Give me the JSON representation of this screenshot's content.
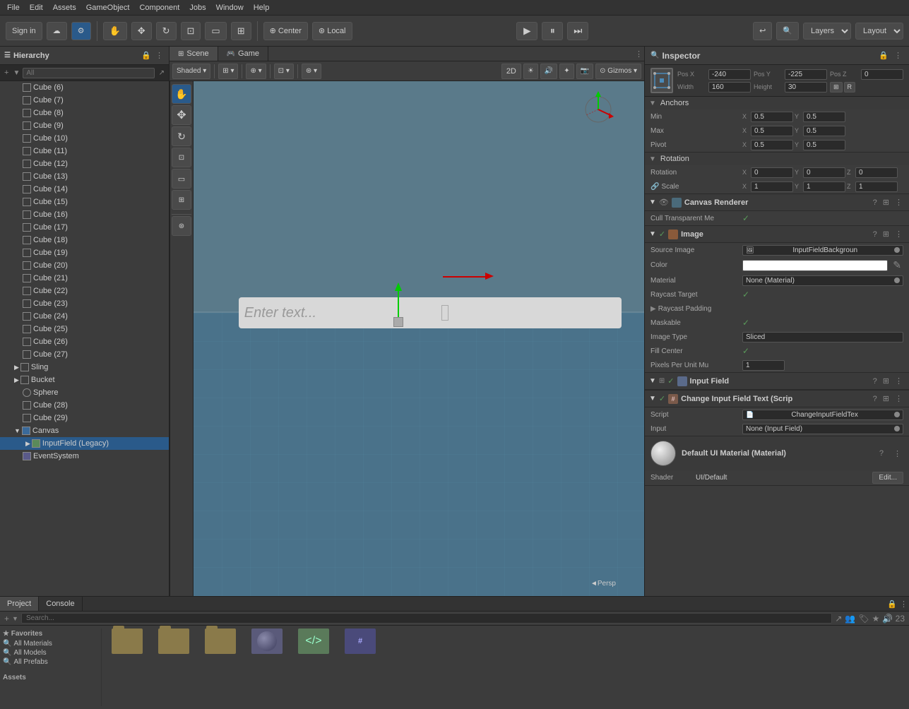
{
  "menubar": {
    "items": [
      "File",
      "Edit",
      "Assets",
      "GameObject",
      "Component",
      "Jobs",
      "Window",
      "Help"
    ]
  },
  "toolbar": {
    "sign_in": "Sign in",
    "layers_label": "Layers",
    "layout_label": "Layout",
    "play_tooltip": "Play",
    "pause_tooltip": "Pause",
    "step_tooltip": "Step"
  },
  "hierarchy": {
    "title": "Hierarchy",
    "search_placeholder": "All",
    "items": [
      {
        "label": "Cube (6)",
        "indent": 0,
        "has_arrow": false
      },
      {
        "label": "Cube (7)",
        "indent": 0,
        "has_arrow": false
      },
      {
        "label": "Cube (8)",
        "indent": 0,
        "has_arrow": false
      },
      {
        "label": "Cube (9)",
        "indent": 0,
        "has_arrow": false
      },
      {
        "label": "Cube (10)",
        "indent": 0,
        "has_arrow": false
      },
      {
        "label": "Cube (11)",
        "indent": 0,
        "has_arrow": false
      },
      {
        "label": "Cube (12)",
        "indent": 0,
        "has_arrow": false
      },
      {
        "label": "Cube (13)",
        "indent": 0,
        "has_arrow": false
      },
      {
        "label": "Cube (14)",
        "indent": 0,
        "has_arrow": false
      },
      {
        "label": "Cube (15)",
        "indent": 0,
        "has_arrow": false
      },
      {
        "label": "Cube (16)",
        "indent": 0,
        "has_arrow": false
      },
      {
        "label": "Cube (17)",
        "indent": 0,
        "has_arrow": false
      },
      {
        "label": "Cube (18)",
        "indent": 0,
        "has_arrow": false
      },
      {
        "label": "Cube (19)",
        "indent": 0,
        "has_arrow": false
      },
      {
        "label": "Cube (20)",
        "indent": 0,
        "has_arrow": false
      },
      {
        "label": "Cube (21)",
        "indent": 0,
        "has_arrow": false
      },
      {
        "label": "Cube (22)",
        "indent": 0,
        "has_arrow": false
      },
      {
        "label": "Cube (23)",
        "indent": 0,
        "has_arrow": false
      },
      {
        "label": "Cube (24)",
        "indent": 0,
        "has_arrow": false
      },
      {
        "label": "Cube (25)",
        "indent": 0,
        "has_arrow": false
      },
      {
        "label": "Cube (26)",
        "indent": 0,
        "has_arrow": false
      },
      {
        "label": "Cube (27)",
        "indent": 0,
        "has_arrow": false
      },
      {
        "label": "Sling",
        "indent": 0,
        "has_arrow": true,
        "type": "group"
      },
      {
        "label": "Bucket",
        "indent": 0,
        "has_arrow": true,
        "type": "group"
      },
      {
        "label": "Sphere",
        "indent": 0,
        "has_arrow": false
      },
      {
        "label": "Cube (28)",
        "indent": 0,
        "has_arrow": false
      },
      {
        "label": "Cube (29)",
        "indent": 0,
        "has_arrow": false
      },
      {
        "label": "Canvas",
        "indent": 0,
        "has_arrow": true,
        "type": "group",
        "expanded": true
      },
      {
        "label": "InputField (Legacy)",
        "indent": 1,
        "has_arrow": true,
        "type": "sub",
        "selected": true
      },
      {
        "label": "EventSystem",
        "indent": 0,
        "has_arrow": false
      }
    ]
  },
  "scene": {
    "tab_label": "Scene",
    "game_tab_label": "Game",
    "persp_label": "◄Persp",
    "viewport_placeholder": "Enter text..."
  },
  "inspector": {
    "title": "Inspector",
    "lock_icon": "🔒",
    "pos_x": "-240",
    "pos_y": "-225",
    "pos_z": "0",
    "width": "160",
    "height": "30",
    "anchors": {
      "title": "Anchors",
      "min_x": "0.5",
      "min_y": "0.5",
      "max_x": "0.5",
      "max_y": "0.5",
      "pivot_x": "0.5",
      "pivot_y": "0.5"
    },
    "rotation": {
      "title": "Rotation",
      "x": "0",
      "y": "0",
      "z": "0"
    },
    "scale": {
      "x": "1",
      "y": "1",
      "z": "1"
    },
    "canvas_renderer": {
      "title": "Canvas Renderer",
      "cull_transparent": "Cull Transparent Me",
      "cull_checked": true
    },
    "image": {
      "title": "Image",
      "source_image": "InputFieldBackgroun",
      "material": "None (Material)",
      "raycast_target_checked": true,
      "raycast_padding": "Raycast Padding",
      "maskable_checked": true,
      "image_type": "Sliced",
      "fill_center_checked": true,
      "pixels_per_unit": "1"
    },
    "input_field": {
      "title": "Input Field"
    },
    "change_script": {
      "title": "Change Input Field Text (Scrip",
      "script": "ChangeInputFieldTex",
      "input": "None (Input Field)"
    },
    "material": {
      "name": "Default UI Material (Material)",
      "shader_label": "Shader",
      "shader_value": "UI/Default",
      "edit_label": "Edit..."
    }
  },
  "project": {
    "project_tab": "Project",
    "console_tab": "Console",
    "assets_label": "Assets",
    "count_label": "23",
    "favorites": {
      "title": "★ Favorites",
      "items": [
        "All Materials",
        "All Models",
        "All Prefabs"
      ]
    },
    "assets": [
      {
        "type": "folder",
        "label": ""
      },
      {
        "type": "folder",
        "label": ""
      },
      {
        "type": "folder",
        "label": ""
      },
      {
        "type": "sphere",
        "label": ""
      },
      {
        "type": "script",
        "label": ""
      },
      {
        "type": "cs",
        "label": ""
      }
    ]
  },
  "icons": {
    "hand": "✋",
    "move": "✥",
    "rotate": "↻",
    "scale": "⊡",
    "rect": "▭",
    "transform": "⊞",
    "grid": "⊞",
    "play": "▶",
    "pause": "⏸",
    "step": "⏭",
    "search": "🔍",
    "eye": "👁",
    "lock": "🔒",
    "gear": "⚙",
    "question": "?",
    "more": "⋮",
    "arrow_down": "▼",
    "arrow_right": "▶",
    "plus": "+",
    "chevron_down": "▾",
    "chevron_right": "▸",
    "expand": "↗",
    "cloud": "☁",
    "collab": "⚙",
    "undo": "↩",
    "warning": "⚠"
  }
}
